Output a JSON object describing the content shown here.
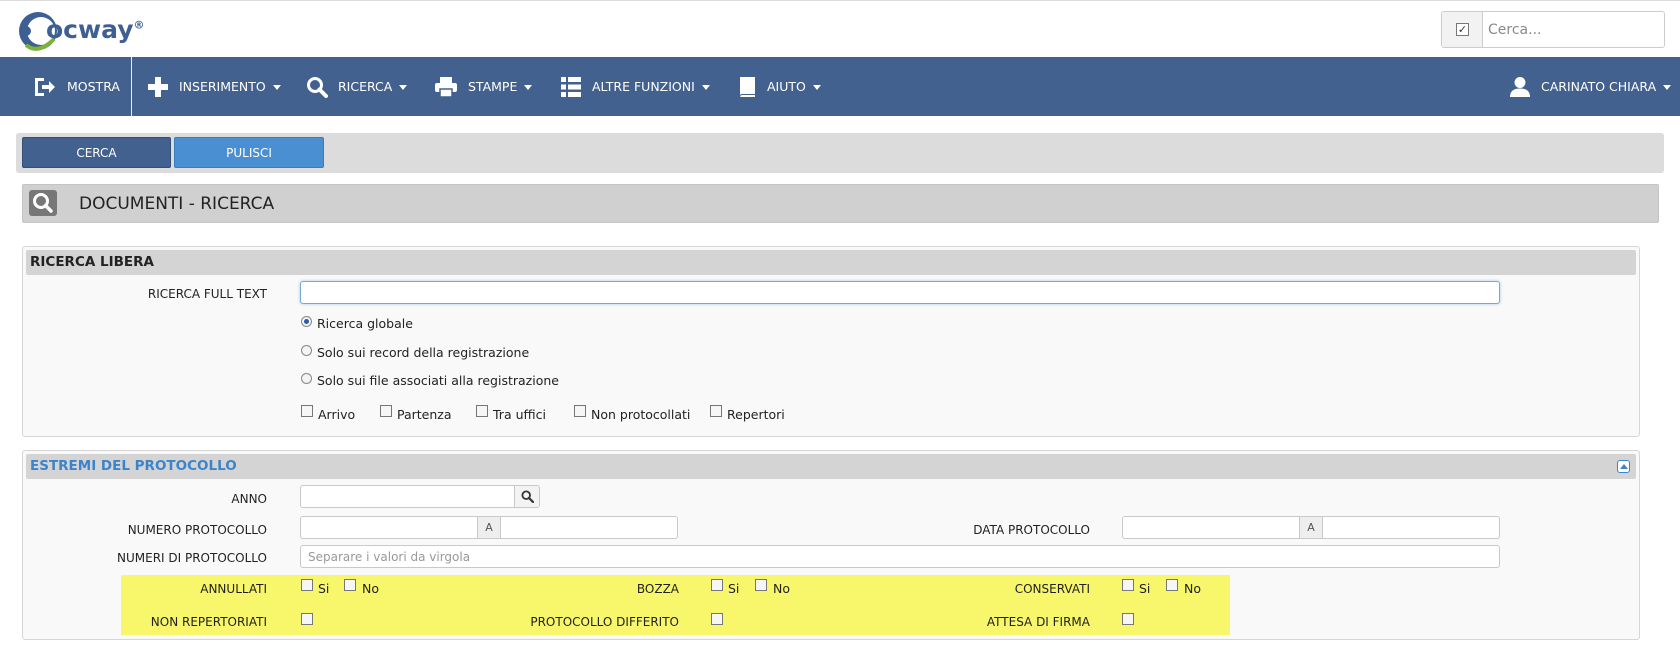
{
  "header": {
    "logo_text": "ocway",
    "logo_reg": "®",
    "search_placeholder": "Cerca..."
  },
  "nav": {
    "items": [
      {
        "label": "MOSTRA",
        "icon": "sign-out-icon"
      },
      {
        "label": "INSERIMENTO",
        "icon": "plus-icon"
      },
      {
        "label": "RICERCA",
        "icon": "search-icon"
      },
      {
        "label": "STAMPE",
        "icon": "print-icon"
      },
      {
        "label": "ALTRE FUNZIONI",
        "icon": "list-icon"
      },
      {
        "label": "AIUTO",
        "icon": "book-icon"
      }
    ],
    "user": "CARINATO CHIARA"
  },
  "actions": {
    "cerca": "CERCA",
    "pulisci": "PULISCI"
  },
  "page_title": "DOCUMENTI - RICERCA",
  "ricerca_libera": {
    "header": "RICERCA LIBERA",
    "fulltext_label": "RICERCA FULL TEXT",
    "fulltext_value": "",
    "radios": [
      {
        "label": "Ricerca globale",
        "checked": true
      },
      {
        "label": "Solo sui record della registrazione",
        "checked": false
      },
      {
        "label": "Solo sui file associati alla registrazione",
        "checked": false
      }
    ],
    "checkboxes": [
      "Arrivo",
      "Partenza",
      "Tra uffici",
      "Non protocollati",
      "Repertori"
    ]
  },
  "estremi": {
    "header": "ESTREMI DEL PROTOCOLLO",
    "anno_label": "ANNO",
    "numero_label": "NUMERO PROTOCOLLO",
    "data_label": "DATA PROTOCOLLO",
    "range_sep": "A",
    "numeri_label": "NUMERI DI PROTOCOLLO",
    "numeri_placeholder": "Separare i valori da virgola",
    "annullati_label": "ANNULLATI",
    "bozza_label": "BOZZA",
    "conservati_label": "CONSERVATI",
    "si": "Si",
    "no": "No",
    "non_repertoriati_label": "NON REPERTORIATI",
    "differito_label": "PROTOCOLLO DIFFERITO",
    "attesa_label": "ATTESA DI FIRMA"
  },
  "colors": {
    "navbar": "#43618f",
    "cerca_button": "#43618f",
    "pulisci_button": "#4a8fd2",
    "highlight": "#f8f66a",
    "section_link": "#3b84cc"
  }
}
